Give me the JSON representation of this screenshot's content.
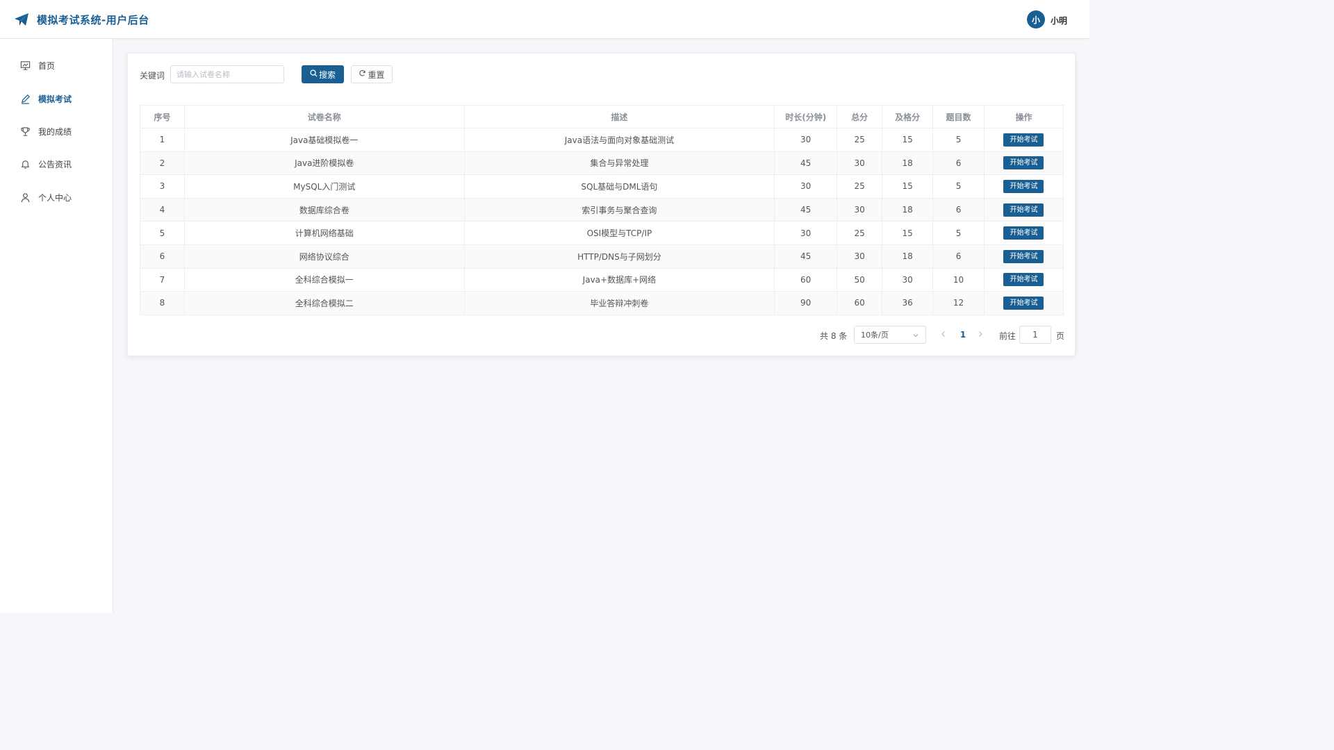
{
  "header": {
    "title": "模拟考试系统-用户后台",
    "user": {
      "avatar_text": "小",
      "name": "小明"
    }
  },
  "sidebar": {
    "items": [
      {
        "label": "首页",
        "icon": "presentation-icon",
        "active": false
      },
      {
        "label": "模拟考试",
        "icon": "edit-pen-icon",
        "active": true
      },
      {
        "label": "我的成绩",
        "icon": "trophy-icon",
        "active": false
      },
      {
        "label": "公告资讯",
        "icon": "bell-icon",
        "active": false
      },
      {
        "label": "个人中心",
        "icon": "user-icon",
        "active": false
      }
    ]
  },
  "search": {
    "label": "关键词",
    "placeholder": "请输入试卷名称",
    "search_button": "搜索",
    "reset_button": "重置"
  },
  "table": {
    "headers": [
      "序号",
      "试卷名称",
      "描述",
      "时长(分钟)",
      "总分",
      "及格分",
      "题目数",
      "操作"
    ],
    "action_label": "开始考试",
    "rows": [
      {
        "index": "1",
        "name": "Java基础模拟卷一",
        "desc": "Java语法与面向对象基础测试",
        "duration": "30",
        "total": "25",
        "pass": "15",
        "count": "5"
      },
      {
        "index": "2",
        "name": "Java进阶模拟卷",
        "desc": "集合与异常处理",
        "duration": "45",
        "total": "30",
        "pass": "18",
        "count": "6"
      },
      {
        "index": "3",
        "name": "MySQL入门测试",
        "desc": "SQL基础与DML语句",
        "duration": "30",
        "total": "25",
        "pass": "15",
        "count": "5"
      },
      {
        "index": "4",
        "name": "数据库综合卷",
        "desc": "索引事务与聚合查询",
        "duration": "45",
        "total": "30",
        "pass": "18",
        "count": "6"
      },
      {
        "index": "5",
        "name": "计算机网络基础",
        "desc": "OSI模型与TCP/IP",
        "duration": "30",
        "total": "25",
        "pass": "15",
        "count": "5"
      },
      {
        "index": "6",
        "name": "网络协议综合",
        "desc": "HTTP/DNS与子网划分",
        "duration": "45",
        "total": "30",
        "pass": "18",
        "count": "6"
      },
      {
        "index": "7",
        "name": "全科综合模拟一",
        "desc": "Java+数据库+网络",
        "duration": "60",
        "total": "50",
        "pass": "30",
        "count": "10"
      },
      {
        "index": "8",
        "name": "全科综合模拟二",
        "desc": "毕业答辩冲刺卷",
        "duration": "90",
        "total": "60",
        "pass": "36",
        "count": "12"
      }
    ]
  },
  "pagination": {
    "total_text": "共 8 条",
    "page_size": "10条/页",
    "current_page": "1",
    "goto_label": "前往",
    "goto_value": "1",
    "page_suffix": "页"
  },
  "colors": {
    "primary": "#1a5f94",
    "background": "#f5f7fa",
    "border": "#ebeef5"
  }
}
